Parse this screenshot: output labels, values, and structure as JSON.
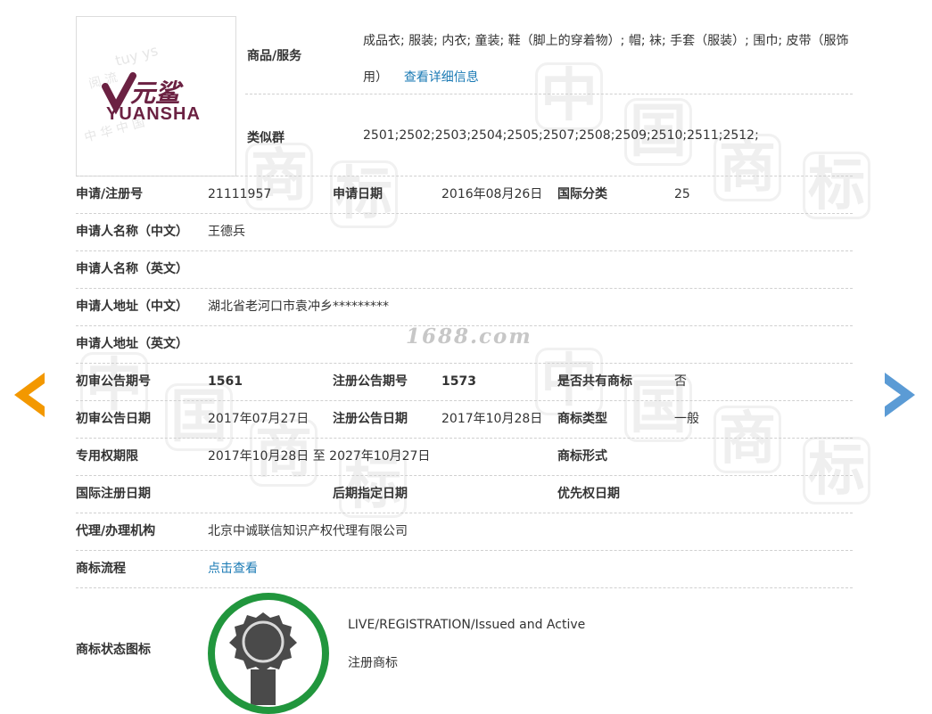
{
  "trademark": {
    "logo_text_cn": "元鲨",
    "logo_text_en": "YUANSHA",
    "goods_label": "商品/服务",
    "goods_value": "成品衣; 服装; 内衣; 童装; 鞋（脚上的穿着物）; 帽; 袜; 手套（服装）; 围巾; 皮带（服饰用）",
    "goods_link": "查看详细信息",
    "similar_label": "类似群",
    "similar_value": "2501;2502;2503;2504;2505;2507;2508;2509;2510;2511;2512;"
  },
  "details": {
    "reg_no_label": "申请/注册号",
    "reg_no": "21111957",
    "app_date_label": "申请日期",
    "app_date": "2016年08月26日",
    "intl_class_label": "国际分类",
    "intl_class": "25",
    "applicant_cn_label": "申请人名称（中文）",
    "applicant_cn": "王德兵",
    "applicant_en_label": "申请人名称（英文）",
    "applicant_en": "",
    "address_cn_label": "申请人地址（中文）",
    "address_cn": "湖北省老河口市袁冲乡*********",
    "address_en_label": "申请人地址（英文）",
    "address_en": "",
    "prelim_no_label": "初审公告期号",
    "prelim_no": "1561",
    "reg_pub_no_label": "注册公告期号",
    "reg_pub_no": "1573",
    "shared_label": "是否共有商标",
    "shared": "否",
    "prelim_date_label": "初审公告日期",
    "prelim_date": "2017年07月27日",
    "reg_pub_date_label": "注册公告日期",
    "reg_pub_date": "2017年10月28日",
    "tm_type_label": "商标类型",
    "tm_type": "一般",
    "exclusive_label": "专用权期限",
    "exclusive": "2017年10月28日 至 2027年10月27日",
    "tm_form_label": "商标形式",
    "tm_form": "",
    "intl_reg_label": "国际注册日期",
    "later_label": "后期指定日期",
    "priority_label": "优先权日期",
    "agent_label": "代理/办理机构",
    "agent": "北京中诚联信知识产权代理有限公司",
    "flow_label": "商标流程",
    "flow_link": "点击查看",
    "status_icon_label": "商标状态图标",
    "status_en": "LIVE/REGISTRATION/Issued and Active",
    "status_cn": "注册商标"
  },
  "watermark": "1688.com",
  "colors": {
    "link": "#1a7ab4",
    "arrow_left": "#f39800",
    "arrow_right": "#5b9bd5",
    "status_ring": "#21963d"
  }
}
